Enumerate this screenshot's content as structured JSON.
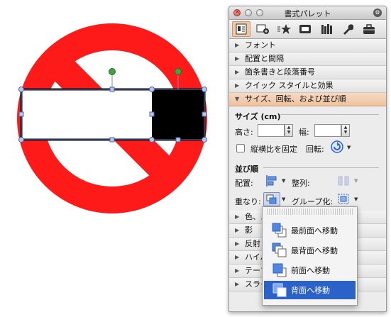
{
  "palette": {
    "title": "書式パレット",
    "toolbar_icons": [
      "text-box-icon",
      "insert-picture-icon",
      "bullets-star-icon",
      "gallery-icon",
      "library-icon",
      "wrench-icon",
      "toolbox-icon"
    ],
    "sections_top": [
      {
        "label": "フォント"
      },
      {
        "label": "配置と間隔"
      },
      {
        "label": "箇条書きと段落番号"
      },
      {
        "label": "クイック スタイルと効果"
      }
    ],
    "open_section": {
      "label": "サイズ、回転、および並び順",
      "size_title": "サイズ (cm)",
      "height_label": "高さ:",
      "height_value": "",
      "width_label": "幅:",
      "width_value": "",
      "lock_aspect_label": "縦横比を固定",
      "lock_aspect_checked": false,
      "rotate_label": "回転:",
      "order_title": "並び順",
      "align_label": "配置:",
      "distribute_label": "整列:",
      "overlap_label": "重なり:",
      "group_label": "グループ化:"
    },
    "sections_bottom": [
      {
        "label": "色、ス"
      },
      {
        "label": "影"
      },
      {
        "label": "反射"
      },
      {
        "label": "ハイパ"
      },
      {
        "label": "テーマ"
      },
      {
        "label": "スライ"
      }
    ]
  },
  "menu": {
    "items": [
      {
        "label": "最前面へ移動",
        "icon": "bring-to-front-icon",
        "selected": false
      },
      {
        "label": "最背面へ移動",
        "icon": "send-to-back-icon",
        "selected": false
      },
      {
        "label": "前面へ移動",
        "icon": "bring-forward-icon",
        "selected": false
      },
      {
        "label": "背面へ移動",
        "icon": "send-backward-icon",
        "selected": true
      }
    ]
  },
  "colors": {
    "sign_red": "#ff1a1a",
    "selection_accent": "#2a62c9",
    "section_open": "#f1c8a6"
  }
}
